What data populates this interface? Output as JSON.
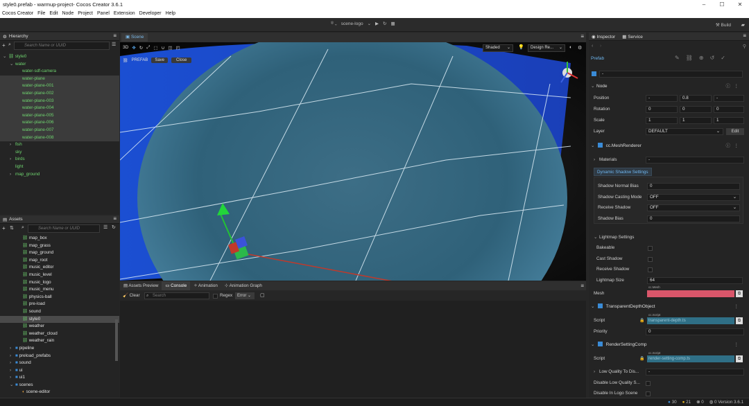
{
  "window": {
    "title": "style0.prefab - warmup-project- Cocos Creator 3.6.1"
  },
  "menu": [
    "Cocos Creator",
    "File",
    "Edit",
    "Node",
    "Project",
    "Panel",
    "Extension",
    "Developer",
    "Help"
  ],
  "toolbar": {
    "scene_name": "scene-logo",
    "build_label": "Build"
  },
  "hierarchy": {
    "title": "Hierarchy",
    "search_placeholder": "Search Name or UUID",
    "rows": [
      {
        "label": "style0",
        "depth": 0,
        "color": "g",
        "arrow": "v",
        "state": ""
      },
      {
        "label": "water",
        "depth": 1,
        "color": "g",
        "arrow": "v",
        "state": ""
      },
      {
        "label": "water-sdf-camera",
        "depth": 2,
        "color": "g",
        "arrow": "",
        "state": ""
      },
      {
        "label": "water-plane",
        "depth": 2,
        "color": "g",
        "arrow": "",
        "state": "sel"
      },
      {
        "label": "water-plane-001",
        "depth": 2,
        "color": "g",
        "arrow": "",
        "state": "sel"
      },
      {
        "label": "water-plane-002",
        "depth": 2,
        "color": "g",
        "arrow": "",
        "state": "sel"
      },
      {
        "label": "water-plane-003",
        "depth": 2,
        "color": "g",
        "arrow": "",
        "state": "sel"
      },
      {
        "label": "water-plane-004",
        "depth": 2,
        "color": "g",
        "arrow": "",
        "state": "sel"
      },
      {
        "label": "water-plane-005",
        "depth": 2,
        "color": "g",
        "arrow": "",
        "state": "sel"
      },
      {
        "label": "water-plane-006",
        "depth": 2,
        "color": "g",
        "arrow": "",
        "state": "sel"
      },
      {
        "label": "water-plane-007",
        "depth": 2,
        "color": "g",
        "arrow": "",
        "state": "sel"
      },
      {
        "label": "water-plane-008",
        "depth": 2,
        "color": "g",
        "arrow": "",
        "state": "sel"
      },
      {
        "label": "fish",
        "depth": 1,
        "color": "g",
        "arrow": ">",
        "state": ""
      },
      {
        "label": "sky",
        "depth": 1,
        "color": "g",
        "arrow": "",
        "state": ""
      },
      {
        "label": "birds",
        "depth": 1,
        "color": "g",
        "arrow": ">",
        "state": ""
      },
      {
        "label": "light",
        "depth": 1,
        "color": "g",
        "arrow": "",
        "state": ""
      },
      {
        "label": "map_ground",
        "depth": 1,
        "color": "g",
        "arrow": ">",
        "state": ""
      }
    ]
  },
  "assets": {
    "title": "Assets",
    "search_placeholder": "Search Name or UUID",
    "rows": [
      {
        "label": "map_box",
        "kind": "prefab",
        "arrow": "",
        "state": ""
      },
      {
        "label": "map_grass",
        "kind": "prefab",
        "arrow": "",
        "state": ""
      },
      {
        "label": "map_ground",
        "kind": "prefab",
        "arrow": "",
        "state": ""
      },
      {
        "label": "map_root",
        "kind": "prefab",
        "arrow": "",
        "state": ""
      },
      {
        "label": "music_editor",
        "kind": "prefab",
        "arrow": "",
        "state": ""
      },
      {
        "label": "music_level",
        "kind": "prefab",
        "arrow": "",
        "state": ""
      },
      {
        "label": "music_logo",
        "kind": "prefab",
        "arrow": "",
        "state": ""
      },
      {
        "label": "music_menu",
        "kind": "prefab",
        "arrow": "",
        "state": ""
      },
      {
        "label": "physics-ball",
        "kind": "prefab",
        "arrow": "",
        "state": ""
      },
      {
        "label": "pre-load",
        "kind": "prefab",
        "arrow": "",
        "state": ""
      },
      {
        "label": "sound",
        "kind": "prefab",
        "arrow": "",
        "state": ""
      },
      {
        "label": "style0",
        "kind": "prefab",
        "arrow": "",
        "state": "sel"
      },
      {
        "label": "weather",
        "kind": "prefab",
        "arrow": "",
        "state": ""
      },
      {
        "label": "weather_cloud",
        "kind": "prefab",
        "arrow": "",
        "state": ""
      },
      {
        "label": "weather_rain",
        "kind": "prefab",
        "arrow": "",
        "state": ""
      },
      {
        "label": "pipeline",
        "kind": "folder",
        "arrow": ">",
        "state": ""
      },
      {
        "label": "preload_prefabs",
        "kind": "folder",
        "arrow": ">",
        "state": ""
      },
      {
        "label": "sound",
        "kind": "folder",
        "arrow": ">",
        "state": ""
      },
      {
        "label": "ui",
        "kind": "folder",
        "arrow": ">",
        "state": ""
      },
      {
        "label": "ui1",
        "kind": "folder",
        "arrow": ">",
        "state": ""
      },
      {
        "label": "scenes",
        "kind": "folder",
        "arrow": "v",
        "state": ""
      },
      {
        "label": "scene-editor",
        "kind": "scene",
        "arrow": "",
        "state": ""
      }
    ]
  },
  "scene": {
    "tab": "Scene",
    "mode_3d": "3D",
    "prefab_label": "PREFAB",
    "save": "Save",
    "close": "Close",
    "shading": "Shaded",
    "resolution": "Design Re..."
  },
  "bottom": {
    "tabs": [
      "Assets Preview",
      "Console",
      "Animation",
      "Animation Graph"
    ],
    "clear": "Clear",
    "search_placeholder": "Search",
    "regex": "Regex",
    "level": "Error"
  },
  "inspector": {
    "tabs": [
      "Inspector",
      "Service"
    ],
    "type": "Prefab",
    "node_name": "-",
    "node_section": "Node",
    "position_label": "Position",
    "position": [
      "-",
      "0.8",
      "-"
    ],
    "rotation_label": "Rotation",
    "rotation": [
      "0",
      "0",
      "0"
    ],
    "scale_label": "Scale",
    "scale": [
      "1",
      "1",
      "1"
    ],
    "layer_label": "Layer",
    "layer": "DEFAULT",
    "edit": "Edit",
    "mesh_renderer": "cc.MeshRenderer",
    "materials_label": "Materials",
    "materials_value": "-",
    "dynamic_shadow": "Dynamic Shadow Settings",
    "shadow_normal_bias_label": "Shadow Normal Bias",
    "shadow_normal_bias": "0",
    "shadow_casting_label": "Shadow Casting Mode",
    "shadow_casting": "OFF",
    "receive_shadow_label": "Receive Shadow",
    "receive_shadow": "OFF",
    "shadow_bias_label": "Shadow Bias",
    "shadow_bias": "0",
    "lightmap": "Lightmap Settings",
    "bakeable": "Bakeable",
    "cast_shadow": "Cast Shadow",
    "receive_shadow2": "Receive Shadow",
    "lightmap_size_label": "Lightmap Size",
    "lightmap_size": "64",
    "mesh_label": "Mesh",
    "mesh_type": "cc.Mesh",
    "tdo": "TransparentDepthObject",
    "script_label": "Script",
    "script_type": "cc.Script",
    "tdo_script": "transparent-depth.ts",
    "priority_label": "Priority",
    "priority": "0",
    "rsc": "RenderSettingComp",
    "rsc_script": "render-setting-comp.ts",
    "low_quality_label": "Low Quality To Dis...",
    "low_quality": "-",
    "disable_lq": "Disable Low Quality S...",
    "disable_logo": "Disable In Logo Scene"
  },
  "status": {
    "info": "30",
    "warn": "21",
    "error": "0",
    "version_count": "0",
    "version": "Version 3.6.1"
  }
}
